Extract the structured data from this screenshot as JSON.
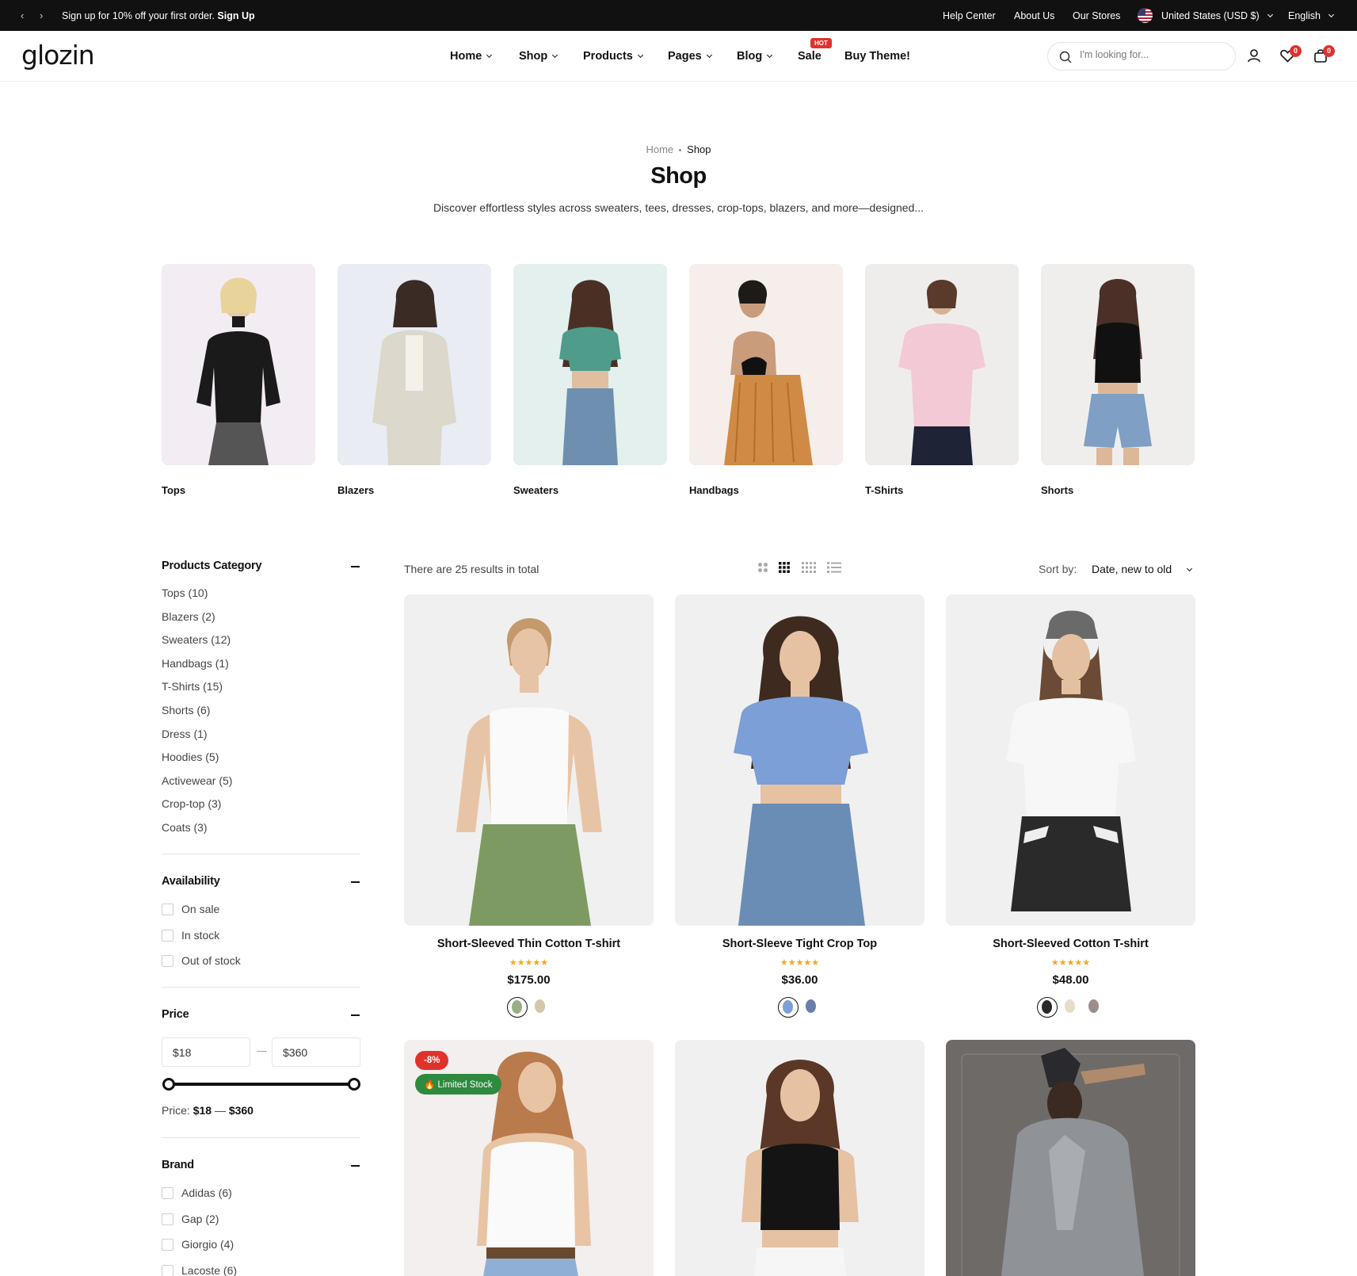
{
  "topbar": {
    "promo_text": "Sign up for 10% off your first order.",
    "promo_link": "Sign Up",
    "links": [
      "Help Center",
      "About Us",
      "Our Stores"
    ],
    "currency": "United States (USD $)",
    "language": "English"
  },
  "header": {
    "logo": "glozin",
    "nav": [
      "Home",
      "Shop",
      "Products",
      "Pages",
      "Blog",
      "Sale",
      "Buy Theme!"
    ],
    "hot_badge": "HOT",
    "search_placeholder": "I'm looking for...",
    "wishlist_count": "0",
    "cart_count": "0"
  },
  "page": {
    "breadcrumb": [
      "Home",
      "Shop"
    ],
    "title": "Shop",
    "description": "Discover effortless styles across sweaters, tees, dresses, crop-tops, blazers, and more—designed..."
  },
  "categories": [
    {
      "label": "Tops",
      "bg": "#f3ecf3"
    },
    {
      "label": "Blazers",
      "bg": "#e9ecf3"
    },
    {
      "label": "Sweaters",
      "bg": "#e3f0ee"
    },
    {
      "label": "Handbags",
      "bg": "#f6eeea"
    },
    {
      "label": "T-Shirts",
      "bg": "#efedec"
    },
    {
      "label": "Shorts",
      "bg": "#f0eeed"
    }
  ],
  "sidebar": {
    "category_heading": "Products Category",
    "categories": [
      "Tops (10)",
      "Blazers (2)",
      "Sweaters (12)",
      "Handbags (1)",
      "T-Shirts (15)",
      "Shorts (6)",
      "Dress (1)",
      "Hoodies (5)",
      "Activewear (5)",
      "Crop-top (3)",
      "Coats (3)"
    ],
    "availability_heading": "Availability",
    "availability": [
      "On sale",
      "In stock",
      "Out of stock"
    ],
    "price_heading": "Price",
    "price_min": "$18",
    "price_max": "$360",
    "price_dash": "—",
    "price_label": "Price:",
    "price_range_min": "$18",
    "price_range_sep": "—",
    "price_range_max": "$360",
    "brand_heading": "Brand",
    "brands": [
      "Adidas (6)",
      "Gap (2)",
      "Giorgio (4)",
      "Lacoste (6)"
    ]
  },
  "toolbar": {
    "results_text": "There are 25 results in total",
    "sort_label": "Sort by:",
    "sort_value": "Date, new to old"
  },
  "products": [
    {
      "name": "Short-Sleeved Thin Cotton T-shirt",
      "stars": "★★★★★",
      "price": "$175.00"
    },
    {
      "name": "Short-Sleeve Tight Crop Top",
      "stars": "★★★★★",
      "price": "$36.00"
    },
    {
      "name": "Short-Sleeved Cotton T-shirt",
      "stars": "★★★★★",
      "price": "$48.00"
    },
    {
      "name": "",
      "discount": "-8%",
      "stock_tag": "🔥 Limited Stock"
    },
    {
      "name": ""
    },
    {
      "name": ""
    }
  ],
  "colors": {
    "accent_red": "#e0322c",
    "star": "#f5a623",
    "limited_green": "#2e8a3e"
  }
}
